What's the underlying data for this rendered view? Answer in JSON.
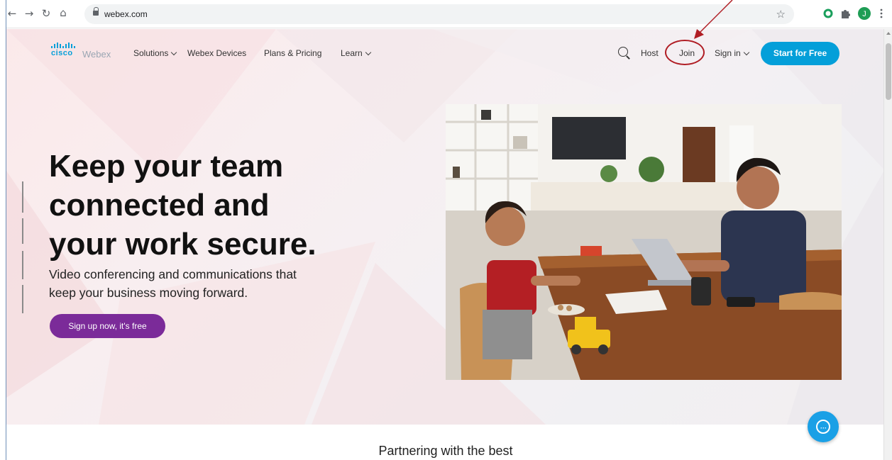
{
  "browser": {
    "url": "webex.com",
    "nav_icons": [
      "back-arrow-icon",
      "forward-arrow-icon",
      "reload-icon",
      "home-icon"
    ],
    "extension_icons": [
      "star-icon",
      "extension-o-icon",
      "puzzle-icon",
      "profile-avatar-icon",
      "menu-dots-icon"
    ],
    "avatar_letter": "J"
  },
  "header": {
    "logo_brand": "cisco",
    "logo_product": "Webex",
    "nav_items": [
      {
        "label": "Solutions",
        "has_dropdown": true
      },
      {
        "label": "Webex Devices",
        "has_dropdown": false
      },
      {
        "label": "Plans & Pricing",
        "has_dropdown": false
      },
      {
        "label": "Learn",
        "has_dropdown": true
      }
    ],
    "host_label": "Host",
    "join_label": "Join",
    "signin_label": "Sign in",
    "start_label": "Start for Free"
  },
  "hero": {
    "title_lines": [
      "Keep your team",
      "connected and",
      "your work secure."
    ],
    "subtitle_lines": [
      "Video conferencing and communications that",
      "keep your business moving forward."
    ],
    "cta_label": "Sign up now, it's free"
  },
  "partner_heading": "Partnering with the best",
  "colors": {
    "brand_blue": "#049fd9",
    "cta_purple": "#7b2b99",
    "annotation_red": "#b01d24",
    "chat_blue": "#1aa0e6"
  }
}
